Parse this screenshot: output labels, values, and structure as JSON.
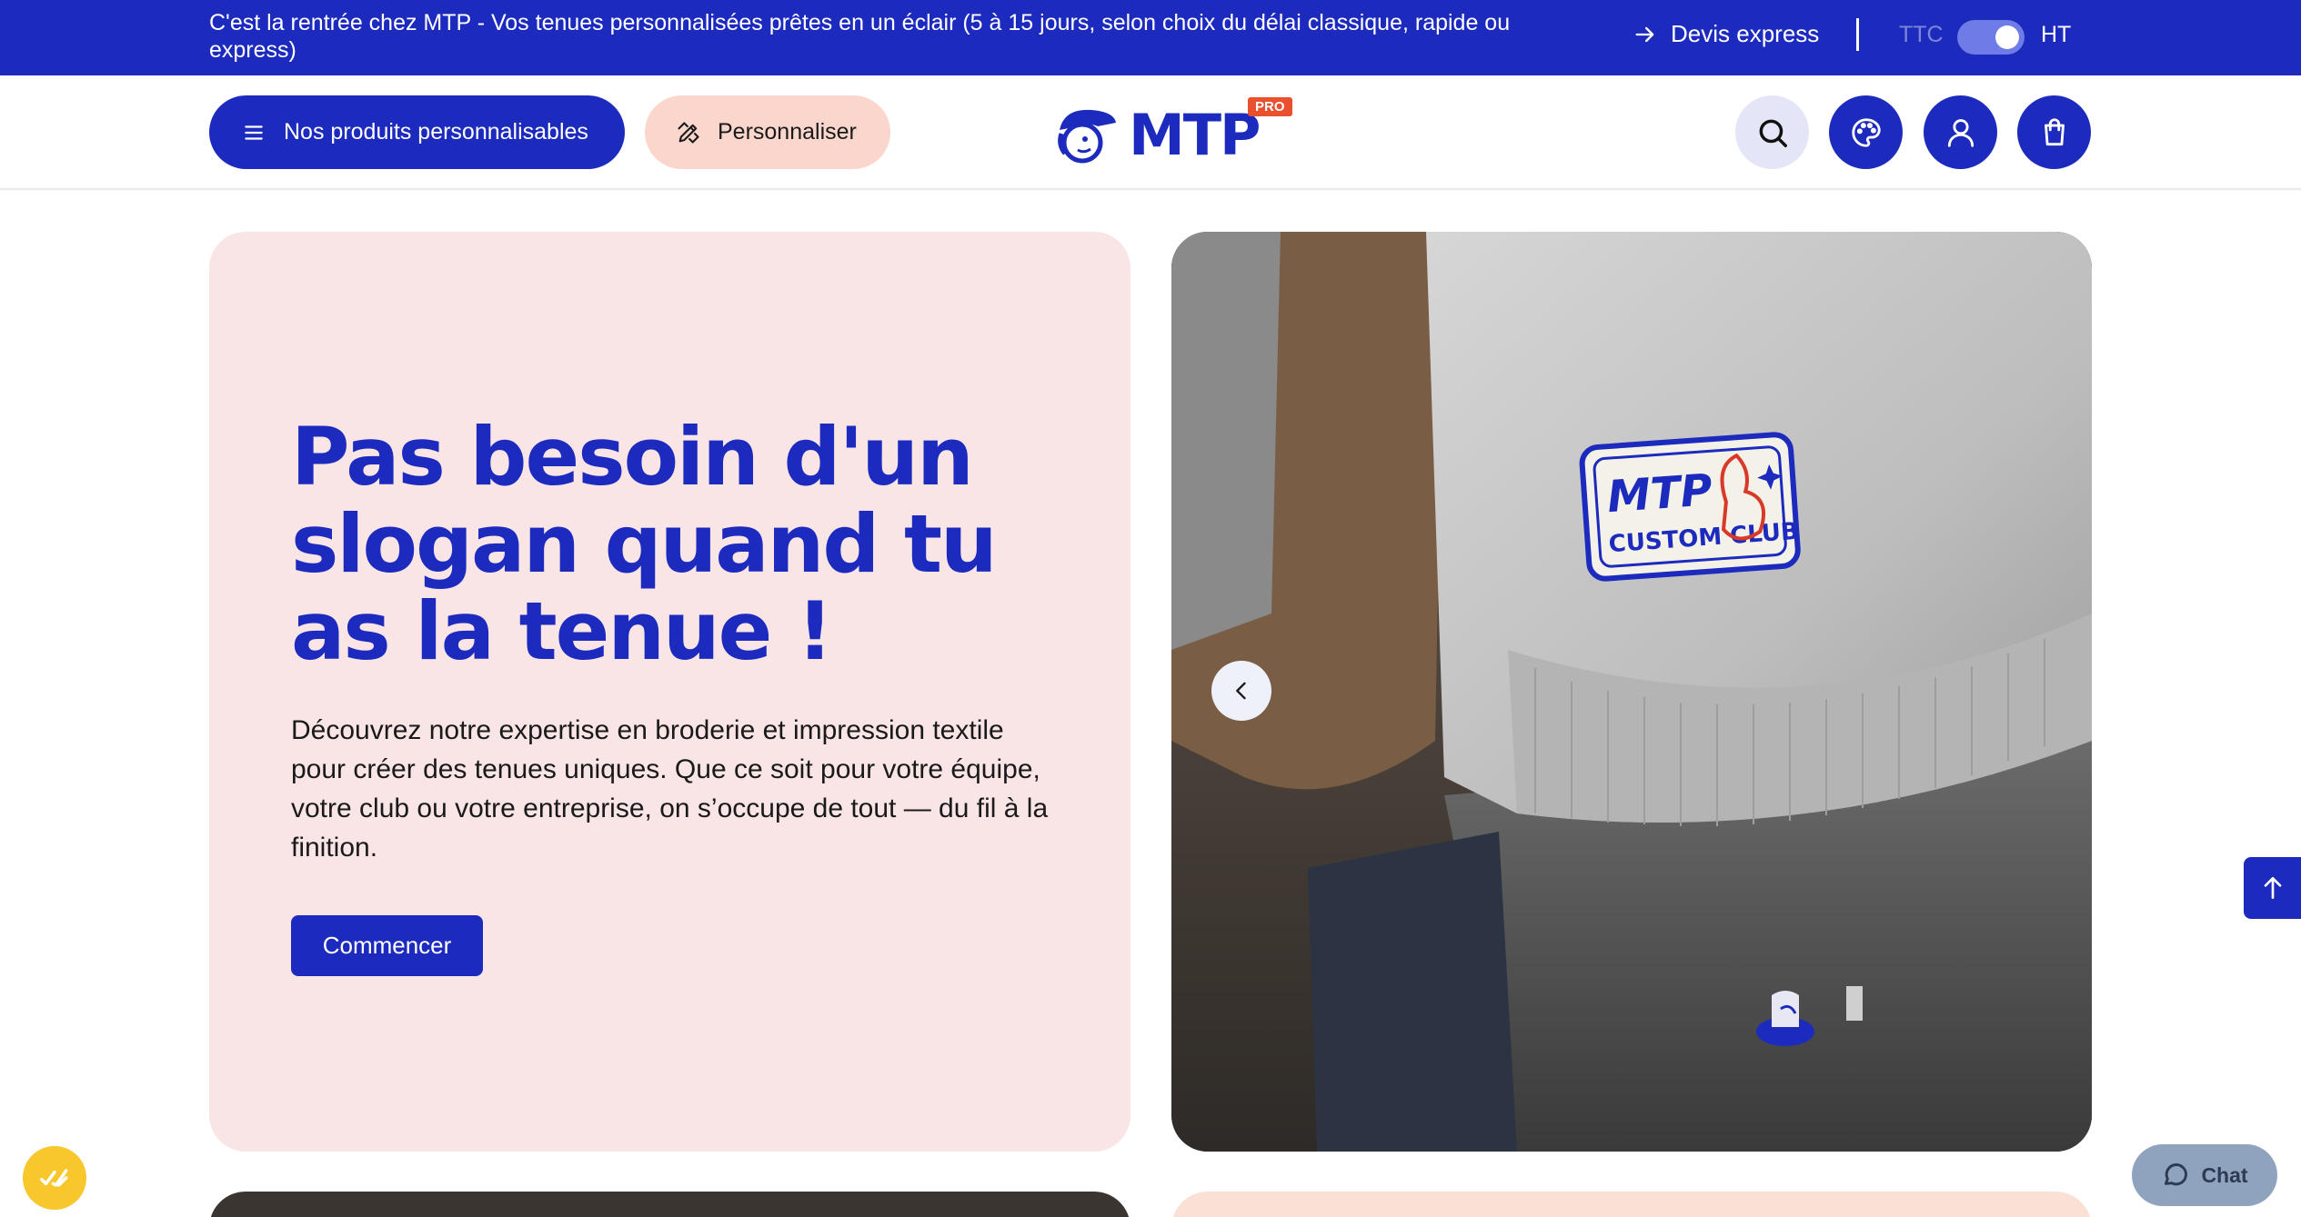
{
  "topbar": {
    "announcement": "C'est la rentrée chez MTP - Vos tenues personnalisées prêtes en un éclair (5 à 15 jours, selon choix du délai classique, rapide ou express)",
    "devis_label": "Devis express",
    "devis_icon": "arrow-right-icon",
    "price_toggle": {
      "left_label": "TTC",
      "right_label": "HT",
      "selected": "HT"
    }
  },
  "header": {
    "products_label": "Nos produits personnalisables",
    "customize_label": "Personnaliser",
    "logo": {
      "text": "MTP",
      "badge": "PRO"
    },
    "icons": [
      "search-icon",
      "palette-icon",
      "user-icon",
      "cart-icon"
    ]
  },
  "hero": {
    "title": "Pas besoin d'un slogan quand tu as la tenue !",
    "text": "Découvrez notre expertise en broderie et impression textile pour créer des tenues uniques. Que ce soit pour votre équipe, votre club ou votre entreprise, on s’occupe de tout — du fil à la finition.",
    "cta_label": "Commencer",
    "image": {
      "patch_line1": "MTP",
      "patch_line2": "CUSTOM CLUB"
    }
  },
  "floating": {
    "chat_label": "Chat"
  },
  "colors": {
    "brand": "#1c2bbd",
    "hero_bg": "#f9e5e6",
    "customize_bg": "#fad6cc",
    "logo_badge": "#e8502e",
    "fab": "#f7c72b"
  }
}
